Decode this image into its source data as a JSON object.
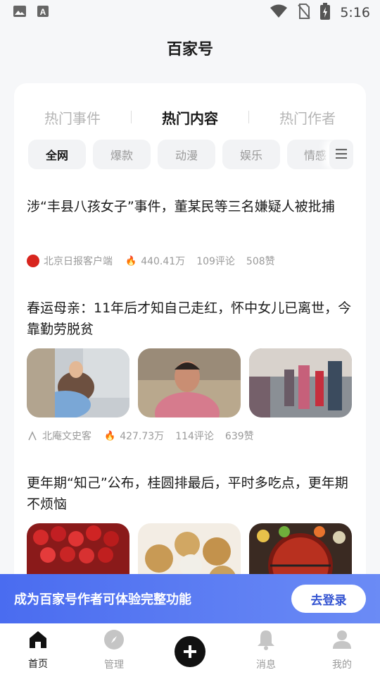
{
  "status_bar": {
    "time": "5:16",
    "icons": [
      "gallery-icon",
      "font-a-icon",
      "wifi-icon",
      "no-sim-icon",
      "battery-charging-icon"
    ]
  },
  "header": {
    "title": "百家号"
  },
  "tabs": [
    {
      "label": "热门事件",
      "active": false
    },
    {
      "label": "热门内容",
      "active": true
    },
    {
      "label": "热门作者",
      "active": false
    }
  ],
  "categories": [
    {
      "label": "全网",
      "active": true
    },
    {
      "label": "爆款",
      "active": false
    },
    {
      "label": "动漫",
      "active": false
    },
    {
      "label": "娱乐",
      "active": false
    },
    {
      "label": "情感",
      "active": false
    }
  ],
  "articles": [
    {
      "headline": "涉“丰县八孩女子”事件，董某民等三名嫌疑人被批捕",
      "source": "北京日报客户端",
      "views": "440.41万",
      "comments": "109评论",
      "likes": "508赞"
    },
    {
      "headline": "春运母亲：11年后才知自己走红，怀中女儿已离世，今靠勤劳脱贫",
      "source": "北庵文史客",
      "views": "427.73万",
      "comments": "114评论",
      "likes": "639赞"
    },
    {
      "headline": "更年期“知己”公布，桂圆排最后，平时多吃点，更年期不烦恼"
    }
  ],
  "login_banner": {
    "message": "成为百家号作者可体验完整功能",
    "button": "去登录"
  },
  "bottom_nav": [
    {
      "label": "首页",
      "icon": "home-icon",
      "active": true
    },
    {
      "label": "管理",
      "icon": "compass-icon",
      "active": false
    },
    {
      "label": "",
      "icon": "plus-icon",
      "active": false
    },
    {
      "label": "消息",
      "icon": "bell-icon",
      "active": false
    },
    {
      "label": "我的",
      "icon": "profile-icon",
      "active": false
    }
  ],
  "colors": {
    "accent": "#4a6cf0",
    "fire": "#e8361f",
    "background": "#f6f7f9"
  }
}
